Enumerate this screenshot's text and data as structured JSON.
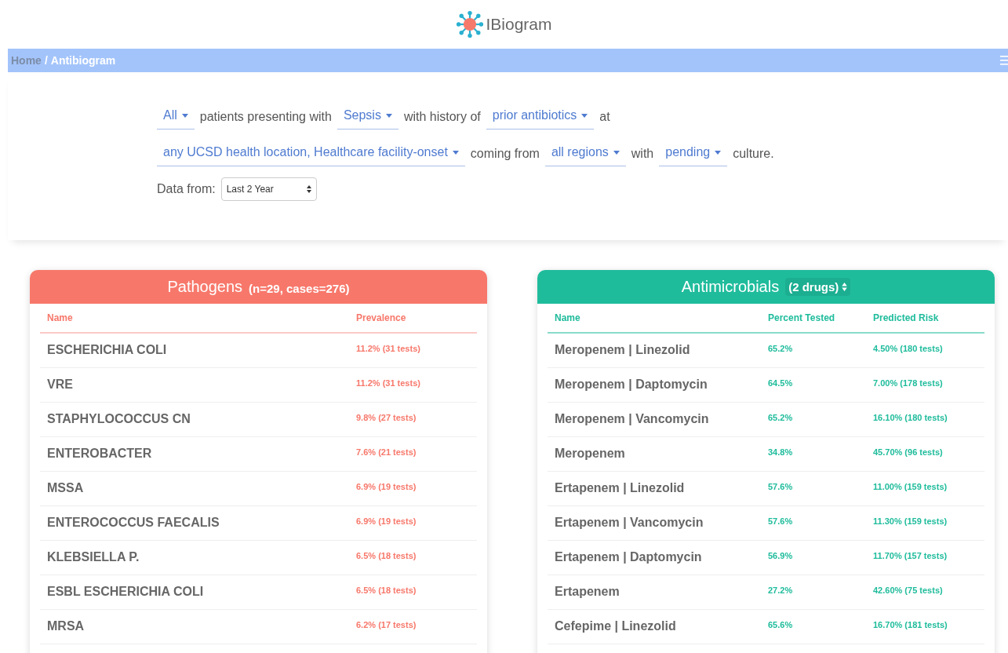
{
  "logo": {
    "text": "IBiogram"
  },
  "breadcrumb": [
    {
      "label": "Home",
      "selected": false
    },
    {
      "label": "Antibiogram",
      "selected": true
    }
  ],
  "breadcrumb_separator": "/",
  "filter_lines": [
    [
      {
        "kind": "dropdown",
        "text": "All"
      },
      {
        "kind": "text",
        "text": "patients presenting with"
      },
      {
        "kind": "dropdown",
        "text": "Sepsis"
      },
      {
        "kind": "text",
        "text": "with history of"
      },
      {
        "kind": "dropdown",
        "text": "prior antibiotics"
      },
      {
        "kind": "text",
        "text": "at"
      }
    ],
    [
      {
        "kind": "dropdown",
        "text": "any UCSD health location, Healthcare facility-onset"
      },
      {
        "kind": "text",
        "text": "coming from"
      },
      {
        "kind": "dropdown",
        "text": "all regions"
      },
      {
        "kind": "text",
        "text": "with"
      },
      {
        "kind": "dropdown",
        "text": "pending"
      },
      {
        "kind": "text",
        "text": "culture."
      }
    ]
  ],
  "data_from": {
    "label": "Data from:",
    "value": "Last 2 Year"
  },
  "pathogens": {
    "title": "Pathogens",
    "subtitle": "(n=29, cases=276)",
    "color": "#f7786b",
    "columns": [
      "Name",
      "Prevalence"
    ],
    "rows": [
      [
        "ESCHERICHIA COLI",
        "11.2% (31 tests)"
      ],
      [
        "VRE",
        "11.2% (31 tests)"
      ],
      [
        "STAPHYLOCOCCUS CN",
        "9.8% (27 tests)"
      ],
      [
        "ENTEROBACTER",
        "7.6% (21 tests)"
      ],
      [
        "MSSA",
        "6.9% (19 tests)"
      ],
      [
        "ENTEROCOCCUS FAECALIS",
        "6.9% (19 tests)"
      ],
      [
        "KLEBSIELLA P.",
        "6.5% (18 tests)"
      ],
      [
        "ESBL ESCHERICHIA COLI",
        "6.5% (18 tests)"
      ],
      [
        "MRSA",
        "6.2% (17 tests)"
      ]
    ]
  },
  "antimicrobials": {
    "title": "Antimicrobials",
    "selector": "(2 drugs)",
    "color": "#1fbc9c",
    "columns": [
      "Name",
      "Percent Tested",
      "Predicted Risk"
    ],
    "rows": [
      [
        "Meropenem | Linezolid",
        "65.2%",
        "4.50% (180 tests)"
      ],
      [
        "Meropenem | Daptomycin",
        "64.5%",
        "7.00% (178 tests)"
      ],
      [
        "Meropenem | Vancomycin",
        "65.2%",
        "16.10% (180 tests)"
      ],
      [
        "Meropenem",
        "34.8%",
        "45.70% (96 tests)"
      ],
      [
        "Ertapenem | Linezolid",
        "57.6%",
        "11.00% (159 tests)"
      ],
      [
        "Ertapenem | Vancomycin",
        "57.6%",
        "11.30% (159 tests)"
      ],
      [
        "Ertapenem | Daptomycin",
        "56.9%",
        "11.70% (157 tests)"
      ],
      [
        "Ertapenem",
        "27.2%",
        "42.60% (75 tests)"
      ],
      [
        "Cefepime | Linezolid",
        "65.6%",
        "16.70% (181 tests)"
      ]
    ]
  }
}
